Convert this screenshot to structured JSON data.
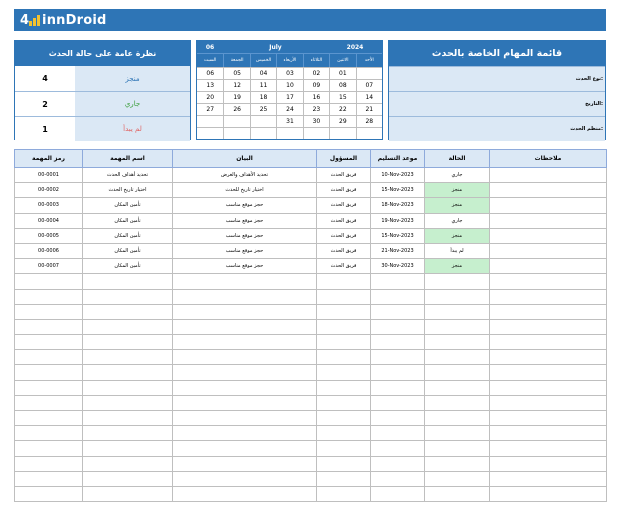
{
  "brand": {
    "name": "innDroid",
    "prefix": "4",
    "accent": "#f2c230"
  },
  "colors": {
    "header": "#2e75b6",
    "light": "#dbe8f5",
    "done": "#c6efce",
    "not_started": "#e06666",
    "in_progress": "#3a9e3a",
    "done_text": "#2e75b6"
  },
  "overview": {
    "title": "نظرة عامة على حالة الحدث",
    "rows": [
      {
        "label": "منجز",
        "count": "4"
      },
      {
        "label": "جاري",
        "count": "2"
      },
      {
        "label": "لم يبدأ",
        "count": "1"
      }
    ]
  },
  "calendar": {
    "month_num": "06",
    "month": "July",
    "year": "2024",
    "days": [
      "السبت",
      "الجمعة",
      "الخميس",
      "الأربعاء",
      "الثلاثاء",
      "الاثنين",
      "الأحد"
    ],
    "cells": [
      "06",
      "05",
      "04",
      "03",
      "02",
      "01",
      "",
      "13",
      "12",
      "11",
      "10",
      "09",
      "08",
      "07",
      "20",
      "19",
      "18",
      "17",
      "16",
      "15",
      "14",
      "27",
      "26",
      "25",
      "24",
      "23",
      "22",
      "21",
      "",
      "",
      "",
      "31",
      "30",
      "29",
      "28",
      "",
      "",
      "",
      "",
      "",
      "",
      ""
    ]
  },
  "title_box": {
    "title": "قائمة المهام الخاصة بالحدث",
    "fields": [
      "نوع الحدث:",
      "التاريخ:",
      "منظم الحدث:"
    ]
  },
  "table": {
    "headers": [
      "رمز المهمة",
      "اسم المهمة",
      "البيان",
      "المسؤول",
      "موعد التسليم",
      "الحالة",
      "ملاحظات"
    ],
    "rows": [
      [
        "00-0001",
        "تحديد أهداف الحدث",
        "تحديد الأهداف والغرض",
        "فريق الحدث",
        "10-Nov-2023",
        "جاري",
        ""
      ],
      [
        "00-0002",
        "اختيار تاريخ الحدث",
        "اختيار تاريخ للحدث",
        "فريق الحدث",
        "15-Nov-2023",
        "منجز",
        ""
      ],
      [
        "00-0003",
        "تأمين المكان",
        "حجز موقع مناسب",
        "فريق الحدث",
        "18-Nov-2023",
        "منجز",
        ""
      ],
      [
        "00-0004",
        "تأمين المكان",
        "حجز موقع مناسب",
        "فريق الحدث",
        "19-Nov-2023",
        "جاري",
        ""
      ],
      [
        "00-0005",
        "تأمين المكان",
        "حجز موقع مناسب",
        "فريق الحدث",
        "15-Nov-2023",
        "منجز",
        ""
      ],
      [
        "00-0006",
        "تأمين المكان",
        "حجز موقع مناسب",
        "فريق الحدث",
        "21-Nov-2023",
        "لم يبدأ",
        ""
      ],
      [
        "00-0007",
        "تأمين المكان",
        "حجز موقع مناسب",
        "فريق الحدث",
        "30-Nov-2023",
        "منجز",
        ""
      ]
    ],
    "empty_rows": 15
  }
}
